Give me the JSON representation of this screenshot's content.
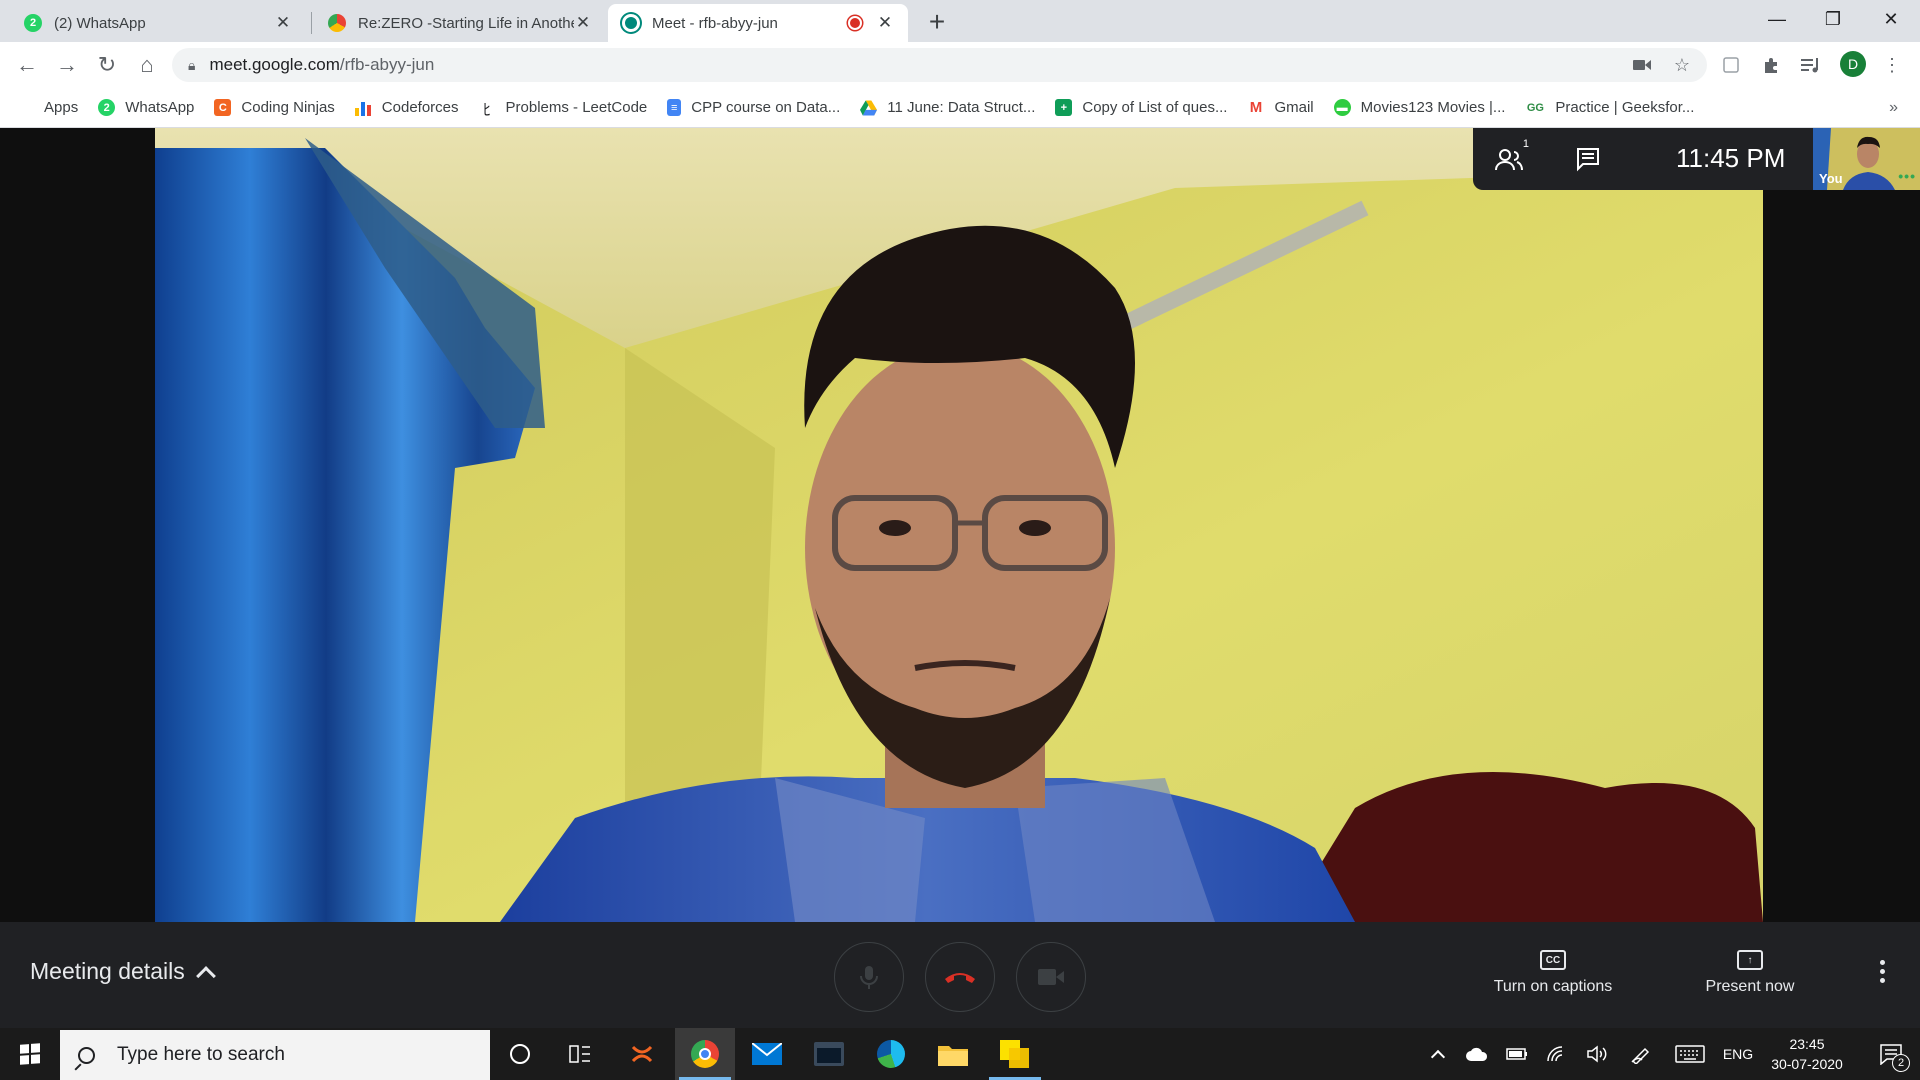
{
  "browser": {
    "tabs": [
      {
        "title": "(2) WhatsApp",
        "close": "✕"
      },
      {
        "title": "Re:ZERO -Starting Life in Another",
        "close": "✕"
      },
      {
        "title": "Meet - rfb-abyy-jun",
        "close": "✕"
      }
    ],
    "new_tab": "+",
    "window_controls": {
      "minimize": "—",
      "restore": "❐",
      "close": "✕"
    },
    "url_host": "meet.google.com",
    "url_path": "/rfb-abyy-jun",
    "profile_initial": "D",
    "bookmarks": [
      {
        "label": "Apps",
        "icon": "apps-grid-icon",
        "color": "#4285f4"
      },
      {
        "label": "WhatsApp",
        "icon": "whatsapp-icon",
        "color": "#25d366",
        "glyph": "2"
      },
      {
        "label": "Coding Ninjas",
        "icon": "coding-ninjas-icon",
        "color": "#f26522",
        "glyph": "C"
      },
      {
        "label": "Codeforces",
        "icon": "codeforces-icon",
        "color": "#1a73e8"
      },
      {
        "label": "Problems - LeetCode",
        "icon": "leetcode-icon",
        "color": "#202124"
      },
      {
        "label": "CPP course on Data...",
        "icon": "google-docs-icon",
        "color": "#4285f4"
      },
      {
        "label": "11 June: Data Struct...",
        "icon": "google-drive-icon",
        "color": "#fbbc04"
      },
      {
        "label": "Copy of List of ques...",
        "icon": "google-sheets-icon",
        "color": "#0f9d58"
      },
      {
        "label": "Gmail",
        "icon": "gmail-icon",
        "color": "#ea4335",
        "glyph": "M"
      },
      {
        "label": "Movies123 Movies |...",
        "icon": "movies123-icon",
        "color": "#2ecc40"
      },
      {
        "label": "Practice | Geeksfor...",
        "icon": "geeksforgeeks-icon",
        "color": "#2f8d46",
        "glyph": "GG"
      }
    ],
    "bookmarks_more": "»"
  },
  "meet": {
    "time": "11:45 PM",
    "participants_count": "1",
    "self_label": "You",
    "self_dots": "•••",
    "meeting_details": "Meeting details",
    "captions_label": "Turn on captions",
    "captions_icon_text": "CC",
    "present_label": "Present now",
    "colors": {
      "hangup": "#d93025",
      "bar": "#202124"
    }
  },
  "taskbar": {
    "search_placeholder": "Type here to search",
    "language": "ENG",
    "time": "23:45",
    "date": "30-07-2020",
    "notifications": "2"
  }
}
